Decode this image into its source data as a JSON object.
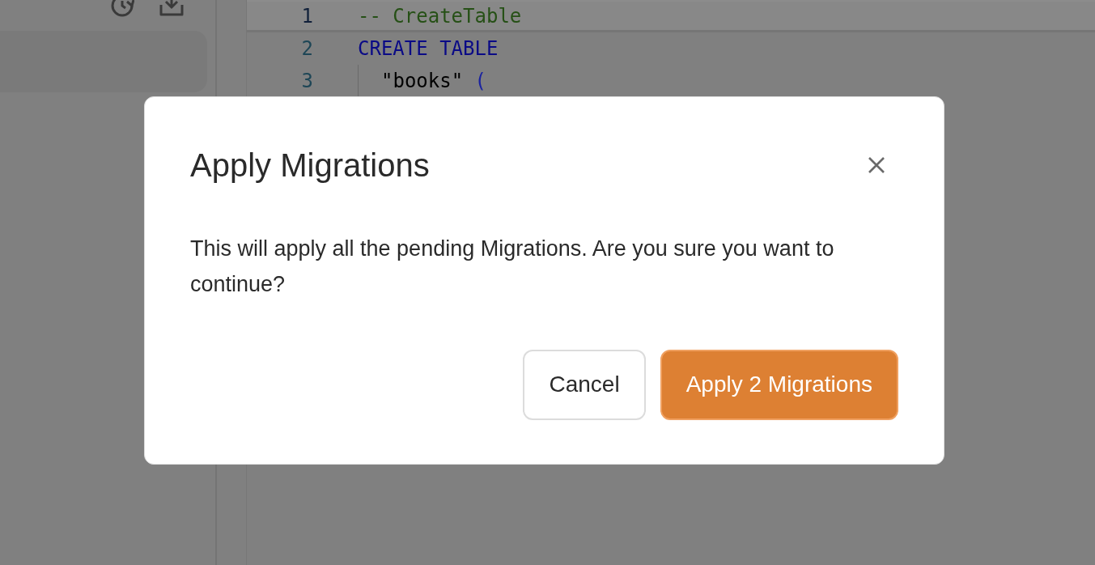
{
  "editor": {
    "lines": [
      {
        "number": "1",
        "selected": true,
        "indented": false,
        "tokens": [
          {
            "kind": "comment",
            "text": "-- CreateTable"
          }
        ]
      },
      {
        "number": "2",
        "selected": false,
        "indented": false,
        "tokens": [
          {
            "kind": "keyword",
            "text": "CREATE TABLE"
          }
        ]
      },
      {
        "number": "3",
        "selected": false,
        "indented": true,
        "tokens": [
          {
            "kind": "string",
            "text": "\"books\" "
          },
          {
            "kind": "punct",
            "text": "("
          }
        ]
      }
    ]
  },
  "dialog": {
    "title": "Apply Migrations",
    "message": "This will apply all the pending Migrations. Are you sure you want to continue?",
    "buttons": [
      {
        "label": "Cancel",
        "kind": "secondary"
      },
      {
        "label": "Apply 2 Migrations",
        "kind": "primary"
      }
    ]
  }
}
